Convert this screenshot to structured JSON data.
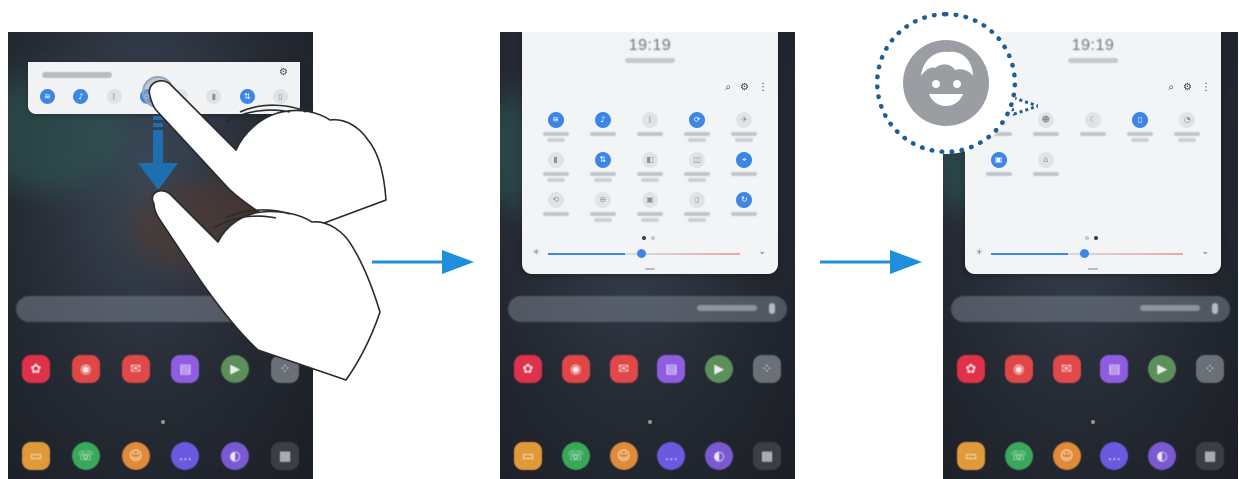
{
  "panels": [
    {
      "id": "step-1",
      "quick_panel": {
        "state": "collapsed",
        "icons": [
          "wifi-icon",
          "sound-icon",
          "bluetooth-icon",
          "auto-rotate-icon",
          "airplane-mode-icon",
          "flashlight-icon",
          "mobile-data-icon",
          "tablet-mode-icon"
        ],
        "active": [
          true,
          true,
          false,
          true,
          false,
          false,
          true,
          false
        ]
      },
      "gesture": "swipe-down"
    },
    {
      "id": "step-2",
      "quick_panel": {
        "state": "expanded",
        "clock": "19:19",
        "page": 1,
        "tiles": [
          {
            "icon": "wifi-icon",
            "active": true
          },
          {
            "icon": "sound-icon",
            "active": true
          },
          {
            "icon": "bluetooth-icon",
            "active": false
          },
          {
            "icon": "auto-rotate-icon",
            "active": true
          },
          {
            "icon": "airplane-mode-icon",
            "active": false
          },
          {
            "icon": "power-saving-icon",
            "active": false
          },
          {
            "icon": "mobile-data-icon",
            "active": true
          },
          {
            "icon": "blue-light-filter-icon",
            "active": false
          },
          {
            "icon": "mobile-hotspot-icon",
            "active": false
          },
          {
            "icon": "location-icon",
            "active": true
          },
          {
            "icon": "smart-view-icon",
            "active": false
          },
          {
            "icon": "do-not-disturb-icon",
            "active": false
          },
          {
            "icon": "secure-folder-icon",
            "active": false
          },
          {
            "icon": "tablet-mode-icon",
            "active": false
          },
          {
            "icon": "sync-icon",
            "active": true
          }
        ]
      }
    },
    {
      "id": "step-3",
      "quick_panel": {
        "state": "expanded",
        "clock": "19:19",
        "page": 2,
        "tiles": [
          {
            "icon": "tile-icon",
            "active": false
          },
          {
            "icon": "kids-home-icon",
            "active": false
          },
          {
            "icon": "night-mode-icon",
            "active": false
          },
          {
            "icon": "navigation-bar-icon",
            "active": true
          },
          {
            "icon": "power-key-icon",
            "active": false
          },
          {
            "icon": "video-enhancer-icon",
            "active": true
          },
          {
            "icon": "samsung-dex-icon",
            "active": false
          }
        ]
      },
      "callout_icon": "kids-home-face-icon"
    }
  ],
  "colors": {
    "accent": "#3d86e6",
    "arrow": "#1e8fd8",
    "callout_border": "#1f5d96",
    "panel_bg": "#f3f4f6"
  },
  "brightness_level": 0.4
}
